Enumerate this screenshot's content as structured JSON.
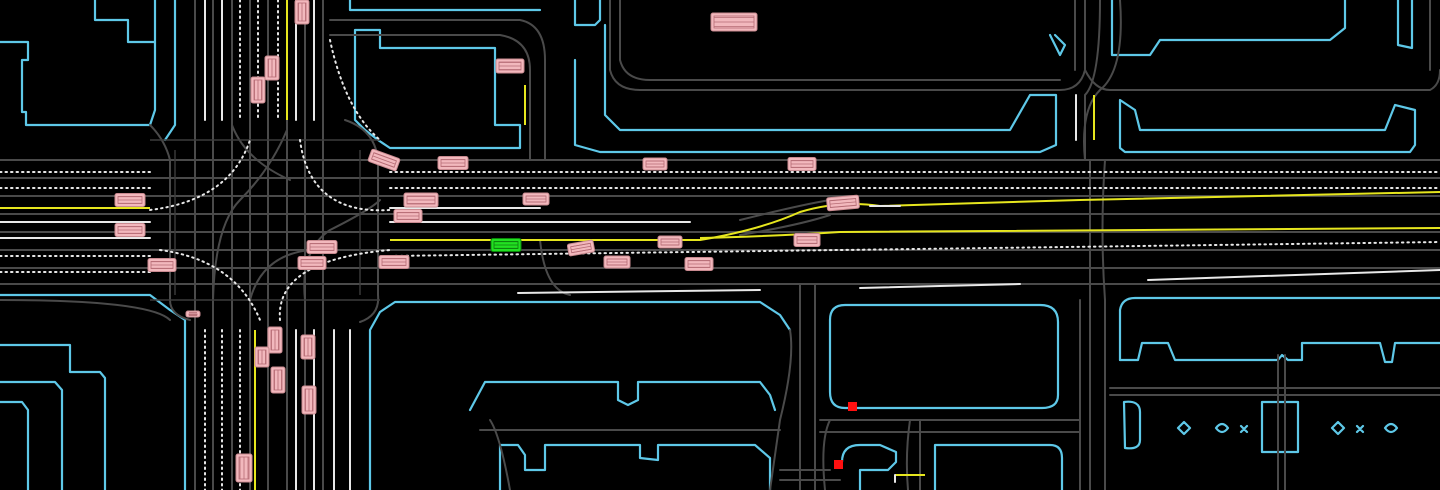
{
  "map": {
    "background": "#000000",
    "colors": {
      "curb": "#5ec8e8",
      "lane_centerline": "#4a4a4a",
      "lane_marking_white": "#e8e8e8",
      "lane_marking_yellow": "#e6e61e",
      "agent_vehicle": "#f2b8bd",
      "ego_vehicle": "#22e022",
      "traffic_signal_stop": "#ff1010"
    },
    "legend": []
  },
  "agents": {
    "ego": {
      "type": "vehicle",
      "color": "#22e022"
    },
    "vehicle_count": 34,
    "traffic_signals_red": 2
  }
}
